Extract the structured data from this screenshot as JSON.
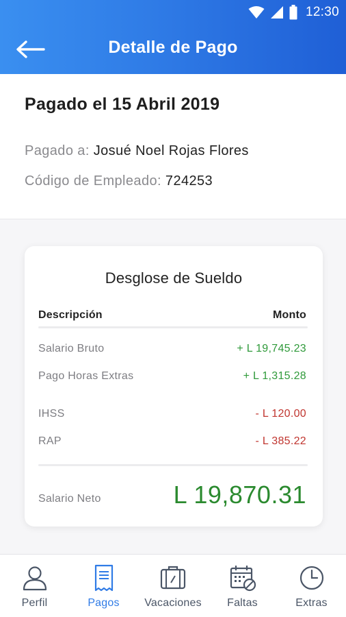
{
  "statusbar": {
    "time": "12:30"
  },
  "header": {
    "title": "Detalle de Pago"
  },
  "payment": {
    "paid_date": "Pagado el 15 Abril 2019",
    "paid_to_label": "Pagado a: ",
    "paid_to_value": "Josué Noel Rojas Flores",
    "employee_code_label": "Código de Empleado: ",
    "employee_code_value": "724253"
  },
  "breakdown": {
    "title": "Desglose de Sueldo",
    "col_description": "Descripción",
    "col_amount": "Monto",
    "rows": [
      {
        "description": "Salario Bruto",
        "amount": "+ L 19,745.23",
        "type": "credit"
      },
      {
        "description": "Pago Horas Extras",
        "amount": "+ L 1,315.28",
        "type": "credit"
      },
      {
        "description": "IHSS",
        "amount": "- L 120.00",
        "type": "debit"
      },
      {
        "description": "RAP",
        "amount": "- L 385.22",
        "type": "debit"
      }
    ],
    "net_label": "Salario Neto",
    "net_value": "L 19,870.31"
  },
  "colors": {
    "header_gradient_start": "#3a8ff0",
    "header_gradient_end": "#1f5fd6",
    "credit": "#2f9a3a",
    "debit": "#c0352f",
    "net": "#2b8a2f",
    "nav_active": "#2f7be6",
    "nav_inactive": "#4a5566"
  },
  "nav": {
    "items": [
      {
        "label": "Perfil",
        "icon": "user-icon",
        "active": false
      },
      {
        "label": "Pagos",
        "icon": "receipt-icon",
        "active": true
      },
      {
        "label": "Vacaciones",
        "icon": "suitcase-icon",
        "active": false
      },
      {
        "label": "Faltas",
        "icon": "calendar-x-icon",
        "active": false
      },
      {
        "label": "Extras",
        "icon": "clock-icon",
        "active": false
      }
    ]
  }
}
